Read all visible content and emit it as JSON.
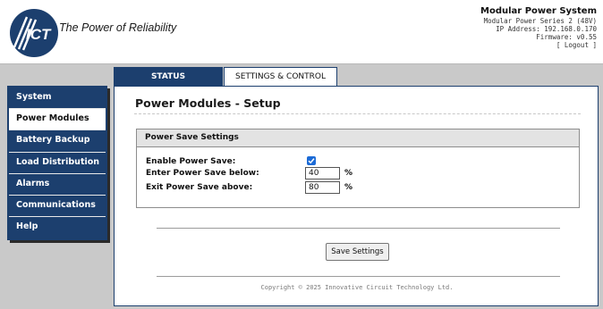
{
  "header": {
    "tagline": "The Power of Reliability",
    "logo_text": "ICT",
    "system_title": "Modular Power System",
    "model": "Modular Power Series 2 (48V)",
    "ip_address": "IP Address: 192.168.0.170",
    "firmware": "Firmware: v0.55",
    "logout_label": "[ Logout ]",
    "brand_color": "#1c3f6e"
  },
  "tabs": [
    {
      "label": "STATUS",
      "active": false
    },
    {
      "label": "SETTINGS & CONTROL",
      "active": true
    }
  ],
  "sidebar": {
    "items": [
      {
        "label": "System",
        "active": false
      },
      {
        "label": "Power Modules",
        "active": true
      },
      {
        "label": "Battery Backup",
        "active": false
      },
      {
        "label": "Load Distribution",
        "active": false
      },
      {
        "label": "Alarms",
        "active": false
      },
      {
        "label": "Communications",
        "active": false
      },
      {
        "label": "Help",
        "active": false
      }
    ]
  },
  "main": {
    "page_title": "Power Modules - Setup",
    "section_title": "Power Save Settings",
    "fields": {
      "enable_label": "Enable Power Save:",
      "enable_checked": true,
      "enter_label": "Enter Power Save below:",
      "enter_value": "40",
      "enter_unit": "%",
      "exit_label": "Exit Power Save above:",
      "exit_value": "80",
      "exit_unit": "%"
    },
    "save_label": "Save Settings",
    "copyright": "Copyright © 2025 Innovative Circuit Technology Ltd."
  }
}
